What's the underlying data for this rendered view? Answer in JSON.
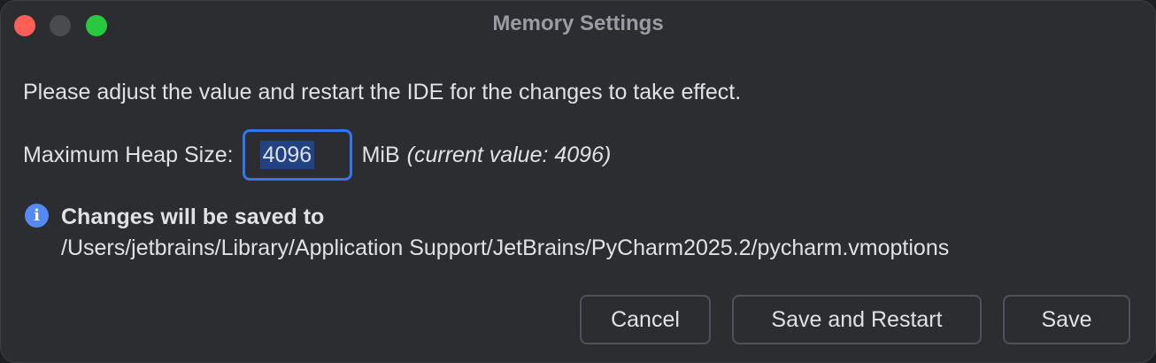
{
  "window": {
    "title": "Memory Settings"
  },
  "message": "Please adjust the value and restart the IDE for the changes to take effect.",
  "heap": {
    "label": "Maximum Heap Size:",
    "value": "4096",
    "unit": "MiB",
    "current_note": "(current value: 4096)"
  },
  "info": {
    "icon": "info-icon",
    "title": "Changes will be saved to",
    "path": "/Users/jetbrains/Library/Application Support/JetBrains/PyCharm2025.2/pycharm.vmoptions"
  },
  "buttons": {
    "cancel": "Cancel",
    "save_restart": "Save and Restart",
    "save": "Save"
  },
  "colors": {
    "accent": "#3574f0",
    "info": "#548af7",
    "close": "#ff5f57",
    "zoom": "#28c840"
  }
}
